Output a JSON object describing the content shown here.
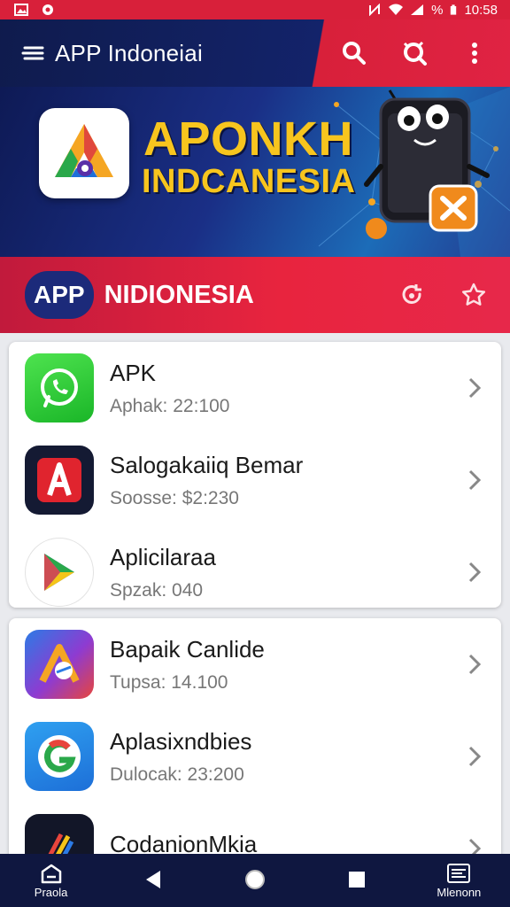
{
  "status_bar": {
    "time": "10:58",
    "battery": "%"
  },
  "app_bar": {
    "title": "APP Indoneiai"
  },
  "banner": {
    "line1": "APONKH",
    "line2": "INDCANESIA"
  },
  "section": {
    "pill": "APP",
    "title": "NIDIONESIA"
  },
  "list1": [
    {
      "title": "APK",
      "sub": "Aphak: 22:100",
      "icon": "whatsapp-icon"
    },
    {
      "title": "Salogakaiiq Bemar",
      "sub": "Soosse: $2:230",
      "icon": "red-a-icon"
    },
    {
      "title": "Aplicilaraa",
      "sub": "Spzak: 040",
      "icon": "play-store-icon"
    }
  ],
  "list2": [
    {
      "title": "Bapaik Canlide",
      "sub": "Tupsa: 14.100",
      "icon": "gradient-a-icon"
    },
    {
      "title": "Aplasixndbies",
      "sub": "Dulocak: 23:200",
      "icon": "g-icon"
    },
    {
      "title": "CodanionMkia",
      "sub": "",
      "icon": "pencils-icon"
    }
  ],
  "bottom_nav": {
    "left_label": "Praola",
    "right_label": "Mlenonn"
  },
  "colors": {
    "navy": "#13236a",
    "red": "#e02343",
    "gold": "#f7c51e"
  }
}
